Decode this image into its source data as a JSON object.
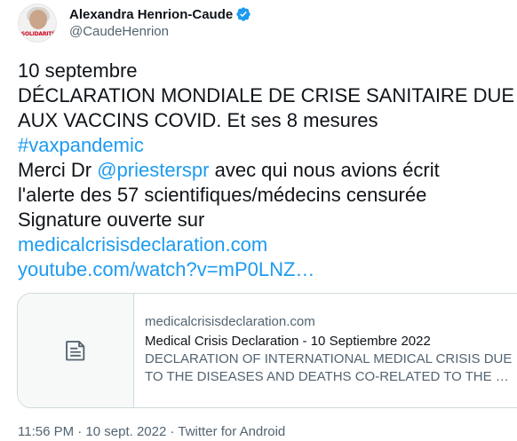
{
  "author": {
    "display_name": "Alexandra Henrion-Caude",
    "handle": "@CaudeHenrion",
    "avatar_badge_text": "SOLIDARITÉ",
    "verified_icon": "verified-badge-icon"
  },
  "tweet": {
    "date_line": "10 septembre",
    "headline_line1": "DÉCLARATION MONDIALE DE CRISE SANITAIRE DUE",
    "headline_line2": "AUX VACCINS COVID. Et ses 8 mesures",
    "hashtag": "#vaxpandemic",
    "thanks_prefix": "Merci Dr ",
    "mention": "@priesterspr",
    "thanks_suffix": " avec qui nous avions écrit",
    "alert_line": "l'alerte des 57 scientifiques/médecins censurée",
    "signature_line": "Signature ouverte sur",
    "link1": "medicalcrisisdeclaration.com",
    "link2": "youtube.com/watch?v=mP0LNZ…"
  },
  "card": {
    "icon": "document-icon",
    "domain": "medicalcrisisdeclaration.com",
    "title": "Medical Crisis Declaration - 10 Septiembre 2022",
    "desc_line1": "DECLARATION OF INTERNATIONAL MEDICAL CRISIS DUE",
    "desc_line2": "TO THE DISEASES AND DEATHS CO-RELATED TO THE …"
  },
  "meta": {
    "text": "11:56 PM · 10 sept. 2022 · Twitter for Android"
  },
  "colors": {
    "link": "#1d9bf0",
    "text": "#0f1419",
    "secondary": "#536471",
    "border": "#cfd9de"
  }
}
